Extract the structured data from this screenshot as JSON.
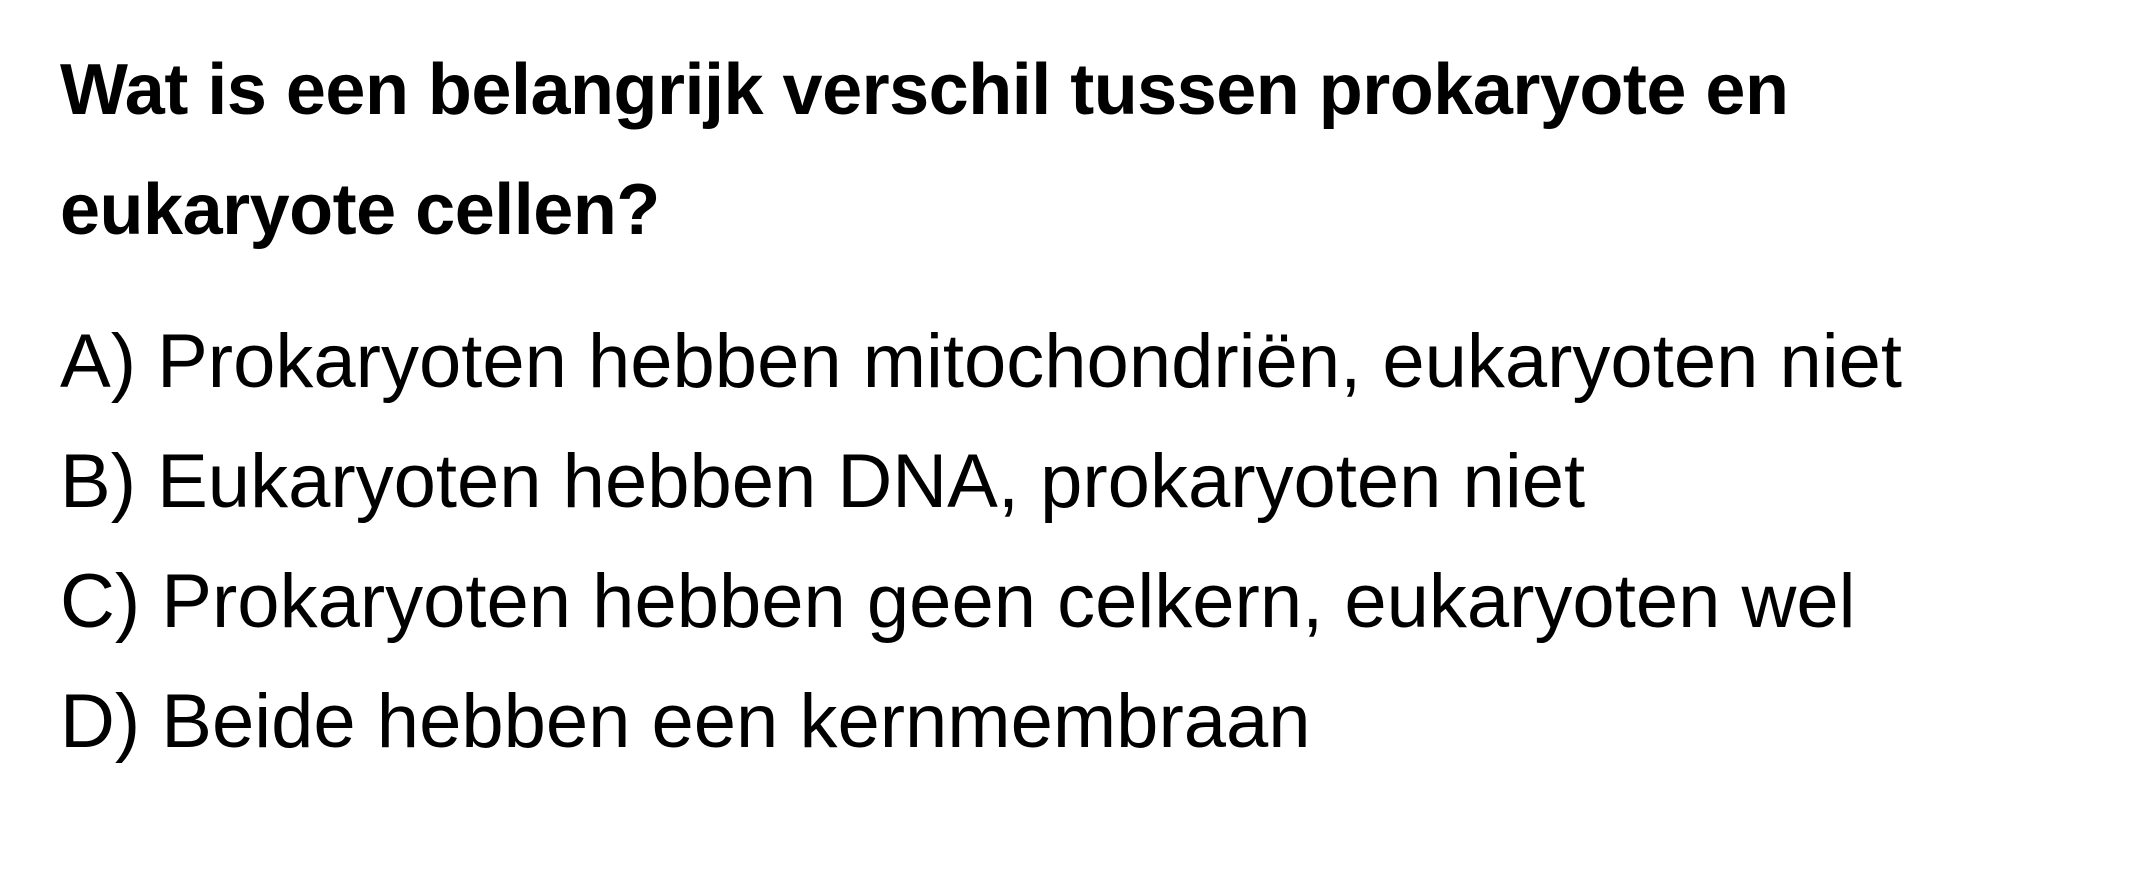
{
  "question": {
    "text": "Wat is een belangrijk verschil tussen prokaryote en eukaryote cellen?"
  },
  "options": [
    {
      "text": "A) Prokaryoten hebben mitochondriën, eukaryoten niet"
    },
    {
      "text": "B) Eukaryoten hebben DNA, prokaryoten niet"
    },
    {
      "text": "C) Prokaryoten hebben geen celkern, eukaryoten wel"
    },
    {
      "text": "D) Beide hebben een kernmembraan"
    }
  ]
}
